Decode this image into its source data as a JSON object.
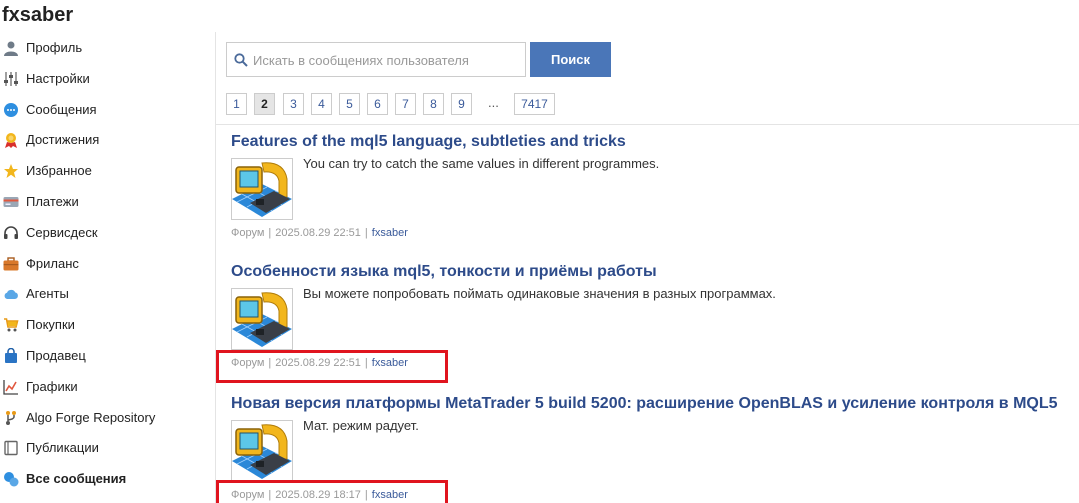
{
  "page": {
    "title": "fxsaber"
  },
  "sidebar": {
    "items": [
      {
        "label": "Профиль",
        "icon": "user-icon"
      },
      {
        "label": "Настройки",
        "icon": "sliders-icon"
      },
      {
        "label": "Сообщения",
        "icon": "chat-bubble-icon"
      },
      {
        "label": "Достижения",
        "icon": "medal-icon"
      },
      {
        "label": "Избранное",
        "icon": "star-icon"
      },
      {
        "label": "Платежи",
        "icon": "credit-card-icon"
      },
      {
        "label": "Сервисдеск",
        "icon": "headset-icon"
      },
      {
        "label": "Фриланс",
        "icon": "briefcase-icon"
      },
      {
        "label": "Агенты",
        "icon": "cloud-icon"
      },
      {
        "label": "Покупки",
        "icon": "cart-icon"
      },
      {
        "label": "Продавец",
        "icon": "shopping-bag-icon"
      },
      {
        "label": "Графики",
        "icon": "chart-icon"
      },
      {
        "label": "Algo Forge Repository",
        "icon": "fork-icon"
      },
      {
        "label": "Публикации",
        "icon": "book-icon"
      },
      {
        "label": "Все сообщения",
        "icon": "chat-bubbles-icon",
        "active": true
      }
    ]
  },
  "search": {
    "placeholder": "Искать в сообщениях пользователя",
    "value": "",
    "button_label": "Поиск"
  },
  "pagination": {
    "pages": [
      "1",
      "2",
      "3",
      "4",
      "5",
      "6",
      "7",
      "8",
      "9"
    ],
    "current": "2",
    "ellipsis": "...",
    "last": "7417"
  },
  "posts": [
    {
      "title": "Features of the mql5 language, subtleties and tricks",
      "text": "You can try to catch the same values in different programmes.",
      "category": "Форум",
      "date": "2025.08.29 22:51",
      "author": "fxsaber"
    },
    {
      "title": "Особенности языка mql5, тонкости и приёмы работы",
      "text": "Вы можете попробовать поймать одинаковые значения в разных программах.",
      "category": "Форум",
      "date": "2025.08.29 22:51",
      "author": "fxsaber"
    },
    {
      "title": "Новая версия платформы MetaTrader 5 build 5200: расширение OpenBLAS и усиление контроля в MQL5",
      "text": "Мат. режим радует.",
      "category": "Форум",
      "date": "2025.08.29 18:17",
      "author": "fxsaber"
    }
  ],
  "meta_separator": "|",
  "colors": {
    "accent": "#4a76b8",
    "title_link": "#2d4b8a",
    "highlight": "#e0141e"
  }
}
